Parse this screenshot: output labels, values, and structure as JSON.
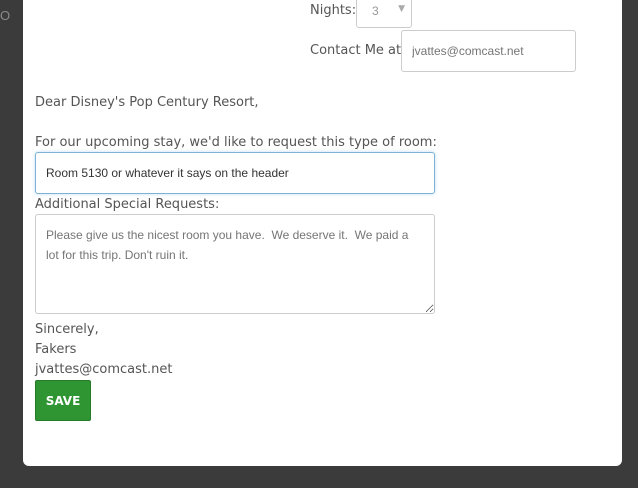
{
  "backdrop": {
    "text": "OK"
  },
  "form": {
    "nights_label": "Nights:",
    "nights_value": "3",
    "contact_label": "Contact Me at:",
    "contact_placeholder": "jvattes@comcast.net",
    "salutation": "Dear Disney's Pop Century Resort,",
    "room_request_label": "For our upcoming stay, we'd like to request this type of room:",
    "room_request_value": "Room 5130 or whatever it says on the header",
    "special_requests_label": "Additional Special Requests:",
    "special_requests_placeholder": "Please give us the nicest room you have.  We deserve it.  We paid a lot for this trip. Don't ruin it.",
    "closing": "Sincerely,",
    "signer_name": "Fakers",
    "signer_email": "jvattes@comcast.net",
    "save_label": "SAVE"
  },
  "colors": {
    "save_button": "#2f9432",
    "focused_border": "#7fb3d5",
    "overlay": "#3b3b3b"
  }
}
